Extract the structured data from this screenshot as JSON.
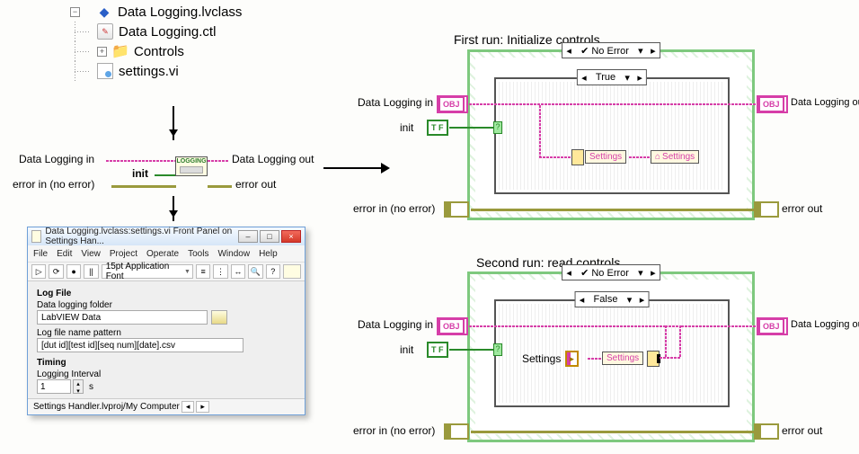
{
  "tree": {
    "items": [
      {
        "icon": "cube",
        "label": "Data Logging.lvclass",
        "expander": "−"
      },
      {
        "icon": "sheet",
        "label": "Data Logging.ctl"
      },
      {
        "icon": "folder",
        "label": "Controls",
        "expander": "+"
      },
      {
        "icon": "vi",
        "label": "settings.vi"
      }
    ]
  },
  "mini_block": {
    "box_label": "LOGGING",
    "in_obj": "Data Logging in",
    "out_obj": "Data Logging out",
    "init": "init",
    "err_in": "error in (no error)",
    "err_out": "error out"
  },
  "front_panel": {
    "title": "Data Logging.lvclass:settings.vi Front Panel on Settings Han...",
    "menus": [
      "File",
      "Edit",
      "View",
      "Project",
      "Operate",
      "Tools",
      "Window",
      "Help"
    ],
    "font": "15pt Application Font",
    "sections": {
      "logfile_head": "Log File",
      "folder_label": "Data logging folder",
      "folder_value": "LabVIEW Data",
      "pattern_label": "Log file name pattern",
      "pattern_value": "[dut id][test id][seq num][date].csv",
      "timing_head": "Timing",
      "interval_label": "Logging Interval",
      "interval_value": "1",
      "interval_unit": "s"
    },
    "status": "Settings Handler.lvproj/My Computer"
  },
  "bd1": {
    "title": "First run:  Initialize controls",
    "outer_selector": "No Error",
    "inner_selector": "True",
    "in_obj": "Data Logging in",
    "out_obj": "Data Logging out",
    "init": "init",
    "err_in": "error in (no error)",
    "err_out": "error out",
    "unbundle": "Settings",
    "propnode": "Settings",
    "obj_text": "OBJ",
    "tf_text": "T F"
  },
  "bd2": {
    "title": "Second run:  read controls",
    "outer_selector": "No Error",
    "inner_selector": "False",
    "in_obj": "Data Logging in",
    "out_obj": "Data Logging out",
    "init": "init",
    "err_in": "error in (no error)",
    "err_out": "error out",
    "local": "Settings",
    "bundle": "Settings",
    "obj_text": "OBJ",
    "tf_text": "T F"
  }
}
